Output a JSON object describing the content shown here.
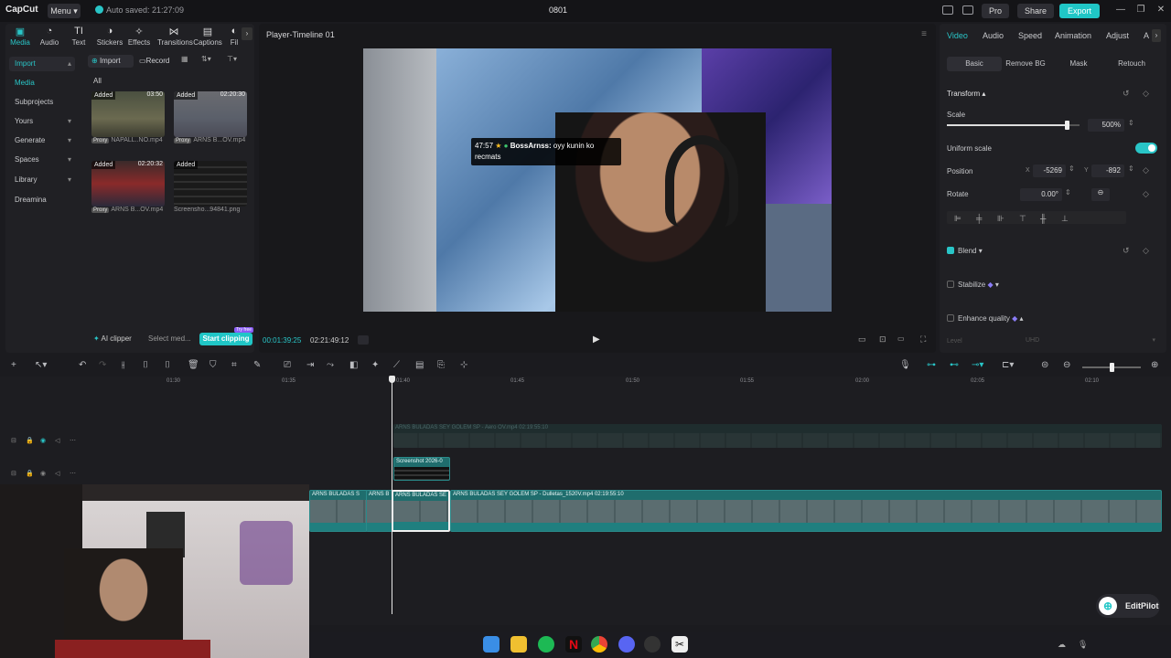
{
  "app": {
    "logo": "CapCut",
    "menu_label": "Menu",
    "autosave": "Auto saved: 21:27:09",
    "project_title": "0801",
    "pro_label": "Pro",
    "share_label": "Share",
    "export_label": "Export"
  },
  "tool_tabs": [
    {
      "label": "Media",
      "icon": "media-icon"
    },
    {
      "label": "Audio",
      "icon": "audio-icon"
    },
    {
      "label": "Text",
      "icon": "text-icon"
    },
    {
      "label": "Stickers",
      "icon": "stickers-icon"
    },
    {
      "label": "Effects",
      "icon": "effects-icon"
    },
    {
      "label": "Transitions",
      "icon": "transitions-icon"
    },
    {
      "label": "Captions",
      "icon": "captions-icon"
    },
    {
      "label": "Fil",
      "icon": "filters-icon"
    }
  ],
  "left_nav": [
    {
      "label": "Import",
      "active": true
    },
    {
      "label": "Media"
    },
    {
      "label": "Subprojects"
    },
    {
      "label": "Yours"
    },
    {
      "label": "Generate"
    },
    {
      "label": "Spaces"
    },
    {
      "label": "Library"
    },
    {
      "label": "Dreamina"
    }
  ],
  "media": {
    "import_label": "Import",
    "record_label": "Record",
    "filter_all": "All",
    "items": [
      {
        "badge": "Added",
        "duration": "03:50",
        "proxy": "Proxy",
        "name": "NAPALL..NO.mp4"
      },
      {
        "badge": "Added",
        "duration": "02:20:30",
        "proxy": "Proxy",
        "name": "ARNS B...OV.mp4"
      },
      {
        "badge": "Added",
        "duration": "02:20:32",
        "proxy": "Proxy",
        "name": "ARNS B...OV.mp4"
      },
      {
        "badge": "Added",
        "duration": "",
        "proxy": "",
        "name": "Screensho...94841.png"
      }
    ],
    "ai_clipper": "AI clipper",
    "select_media": "Select med...",
    "start_clipping": "Start clipping",
    "try_free": "Try free"
  },
  "player": {
    "title": "Player-Timeline 01",
    "chat_time": "47:57",
    "chat_user": "BossArnss:",
    "chat_text": "oyy kunin ko recmats",
    "time_current": "00:01:39:25",
    "time_total": "02:21:49:12"
  },
  "right": {
    "tabs": [
      "Video",
      "Audio",
      "Speed",
      "Animation",
      "Adjust",
      "A"
    ],
    "sub_tabs": [
      "Basic",
      "Remove BG",
      "Mask",
      "Retouch"
    ],
    "transform_label": "Transform",
    "scale_label": "Scale",
    "scale_value": "500%",
    "scale_fraction": 0.9,
    "uniform_scale": "Uniform scale",
    "position_label": "Position",
    "pos_x_label": "X",
    "pos_x": "-5269",
    "pos_y_label": "Y",
    "pos_y": "-892",
    "rotate_label": "Rotate",
    "rotate_value": "0.00°",
    "blend_label": "Blend",
    "stabilize_label": "Stabilize",
    "enhance_label": "Enhance quality",
    "level_label": "Level",
    "level_value": "UHD"
  },
  "timeline": {
    "ticks": [
      "01:30",
      "01:35",
      "01:40",
      "01:45",
      "01:50",
      "01:55",
      "02:00",
      "02:05",
      "02:10"
    ],
    "clip_top_label": "ARNS BULADAS SEY GOLEM SP - Aero OV.mp4 02:19:55:10",
    "clip_small_label": "Screenshot 2026-0",
    "clip_main_a": "ARNS BULADAS S",
    "clip_main_b": "ARNS B",
    "clip_main_c": "ARNS BULADAS SE",
    "clip_main_d": "ARNS BULADAS SEY GOLEM SP - Dulletas_1520V.mp4 02:19:55:10"
  },
  "editpilot_label": "EditPilot",
  "colors": {
    "accent": "#29c5c7",
    "export": "#20c6c6"
  }
}
